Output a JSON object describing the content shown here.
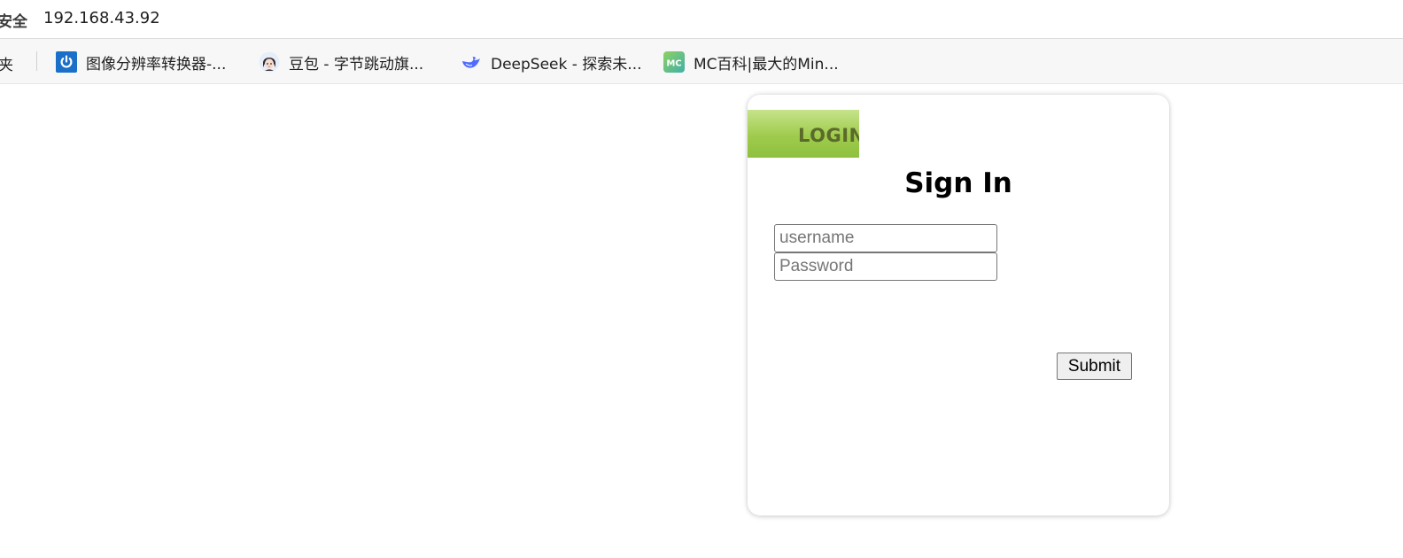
{
  "browser": {
    "security_label": "安全",
    "url": "192.168.43.92"
  },
  "bookmarks_bar": {
    "folder_tail": "夹",
    "items": [
      {
        "label": "图像分辨率转换器-...",
        "icon": "power-icon"
      },
      {
        "label": "豆包 - 字节跳动旗...",
        "icon": "doubao-avatar-icon"
      },
      {
        "label": "DeepSeek - 探索未...",
        "icon": "deepseek-whale-icon"
      },
      {
        "label": "MC百科|最大的Min...",
        "icon": "mc-logo-icon",
        "icon_text": "MC"
      }
    ]
  },
  "login_card": {
    "tab_label": "LOGIN",
    "title": "Sign In",
    "username_placeholder": "username",
    "password_placeholder": "Password",
    "submit_label": "Submit"
  },
  "colors": {
    "tab_gradient_top": "#c6e38a",
    "tab_gradient_bottom": "#8fc03f",
    "tab_text": "#5a6a2a",
    "power_icon_bg": "#1a6fc9",
    "deepseek_blue": "#4d6bfe",
    "mc_green": "#7cc36b"
  }
}
